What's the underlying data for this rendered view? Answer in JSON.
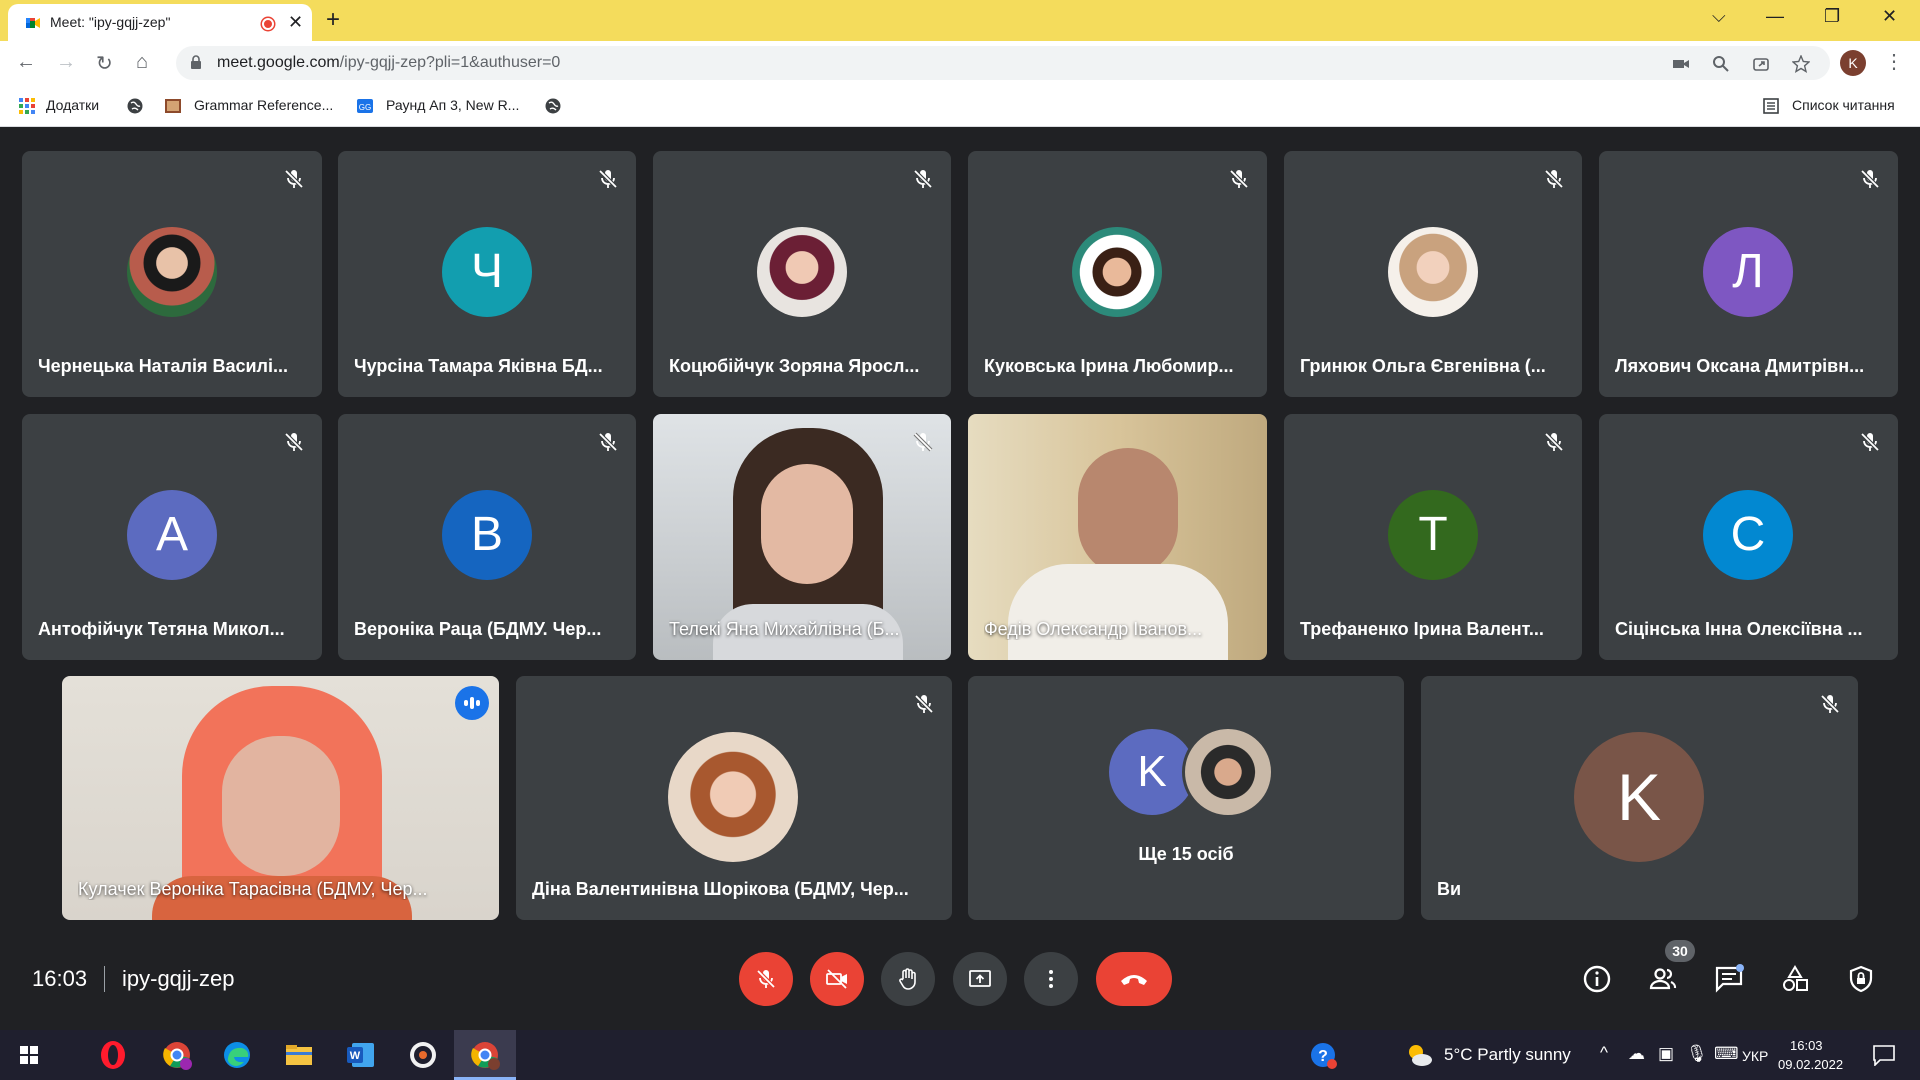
{
  "browser": {
    "tab_title": "Meet: \"ipy-gqjj-zep\"",
    "url_host": "meet.google.com",
    "url_path": "/ipy-gqjj-zep?pli=1&authuser=0",
    "profile_initial": "K",
    "bookmarks": [
      "Додатки",
      "Grammar Reference...",
      "Раунд Ап 3, New R..."
    ],
    "reading_list": "Список читання"
  },
  "meet": {
    "grid": [
      {
        "name": "Чернецька Наталія Василі...",
        "muted": true,
        "kind": "photo",
        "color": "#b85c4c"
      },
      {
        "name": "Чурсіна Тамара Яківна БД...",
        "muted": true,
        "kind": "letter",
        "letter": "Ч",
        "color": "#129eaf"
      },
      {
        "name": "Коцюбійчук Зоряна Яросл...",
        "muted": true,
        "kind": "photo",
        "color": "#8e3a55"
      },
      {
        "name": "Куковська Ірина Любомир...",
        "muted": true,
        "kind": "photo",
        "color": "#a0522d"
      },
      {
        "name": "Гринюк Ольга Євгенівна (...",
        "muted": true,
        "kind": "photo",
        "color": "#c9a27e"
      },
      {
        "name": "Ляхович Оксана Дмитрівн...",
        "muted": true,
        "kind": "letter",
        "letter": "Л",
        "color": "#7e57c2"
      },
      {
        "name": "Антофійчук Тетяна Микол...",
        "muted": true,
        "kind": "letter",
        "letter": "А",
        "color": "#5c6bc0"
      },
      {
        "name": "Вероніка Раца (БДМУ. Чер...",
        "muted": true,
        "kind": "letter",
        "letter": "В",
        "color": "#1565c0"
      },
      {
        "name": "Телекі Яна Михайлівна (Б...",
        "muted": true,
        "kind": "video",
        "color": "#cfd3d6"
      },
      {
        "name": "Федів Олександр Іванов...",
        "muted": false,
        "kind": "video",
        "color": "#d8c49a"
      },
      {
        "name": "Трефаненко Ірина Валент...",
        "muted": true,
        "kind": "letter",
        "letter": "Т",
        "color": "#33691e"
      },
      {
        "name": "Сіцінська Інна Олексіївна ...",
        "muted": true,
        "kind": "letter",
        "letter": "С",
        "color": "#0288d1"
      }
    ],
    "bottom_row": [
      {
        "name": "Кулачек Вероніка Тарасівна (БДМУ, Чер...",
        "kind": "video",
        "speaking": true,
        "color": "#d9d4cc"
      },
      {
        "name": "Діна Валентинівна Шорікова (БДМУ, Чер...",
        "kind": "photo",
        "muted": true,
        "color": "#a8582f"
      },
      {
        "label": "Ще 15 осіб",
        "kind": "others",
        "letter": "K",
        "color": "#5c6bc0"
      },
      {
        "name": "Ви",
        "kind": "letter",
        "letter": "K",
        "muted": true,
        "color": "#795548"
      }
    ],
    "time": "16:03",
    "meeting_code": "ipy-gqjj-zep",
    "participants_count": "30"
  },
  "taskbar": {
    "weather": "5°C  Partly sunny",
    "language": "УКР",
    "time": "16:03",
    "date": "09.02.2022"
  },
  "colors": {
    "tab_bar": "#f4dc5c",
    "meet_bg": "#202124",
    "tile_bg": "#3c4043",
    "danger": "#ea4335"
  }
}
